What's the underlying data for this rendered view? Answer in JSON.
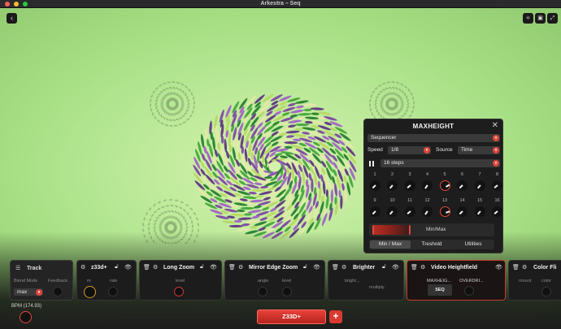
{
  "window": {
    "title": "Arkestra – Seq"
  },
  "toolbar": {
    "back_icon": "chevron-left-icon",
    "right_icons": [
      "nodes-icon",
      "layers-icon",
      "fullscreen-icon"
    ]
  },
  "panel": {
    "title": "MAXHEIGHT",
    "close": "✕",
    "mode_select": "Sequencer",
    "speed_label": "Speed",
    "speed_value": "1/8",
    "source_label": "Source",
    "source_value": "Time",
    "steps_value": "16 steps",
    "steps": [
      "1",
      "2",
      "3",
      "4",
      "5",
      "6",
      "7",
      "8",
      "9",
      "10",
      "11",
      "12",
      "13",
      "14",
      "15",
      "16"
    ],
    "active_steps": [
      "5",
      "13"
    ],
    "minmax_label": "Min/Max",
    "tabs": [
      "Min / Max",
      "Treshold",
      "Utilities"
    ],
    "active_tab": "Min / Max"
  },
  "track": {
    "title": "Track",
    "blend_mode_label": "Blend Mode",
    "feedback_label": "Feedback",
    "blend_value": "max"
  },
  "cards": [
    {
      "title": "z33d+",
      "params": [
        "m",
        "rate"
      ]
    },
    {
      "title": "Long Zoom",
      "params": [
        "level"
      ]
    },
    {
      "title": "Mirror Edge Zoom",
      "params": [
        "angle",
        "level"
      ]
    },
    {
      "title": "Brighter",
      "params": [
        "bright...",
        "multiply"
      ]
    },
    {
      "title": "Video Heightfield",
      "params": [
        "MAXHEIG...",
        "OVERDRI..."
      ],
      "button": "SEQ"
    },
    {
      "title": "Color Fli",
      "params": [
        "mount",
        "color"
      ]
    }
  ],
  "bpm": {
    "label": "BPM (174.93)"
  },
  "bottom": {
    "scene_button": "Z33D+",
    "add_button": "+"
  },
  "colors": {
    "accent": "#e0483c",
    "panel_bg": "#1d1d1d",
    "viz_bg": "#b8e896"
  }
}
